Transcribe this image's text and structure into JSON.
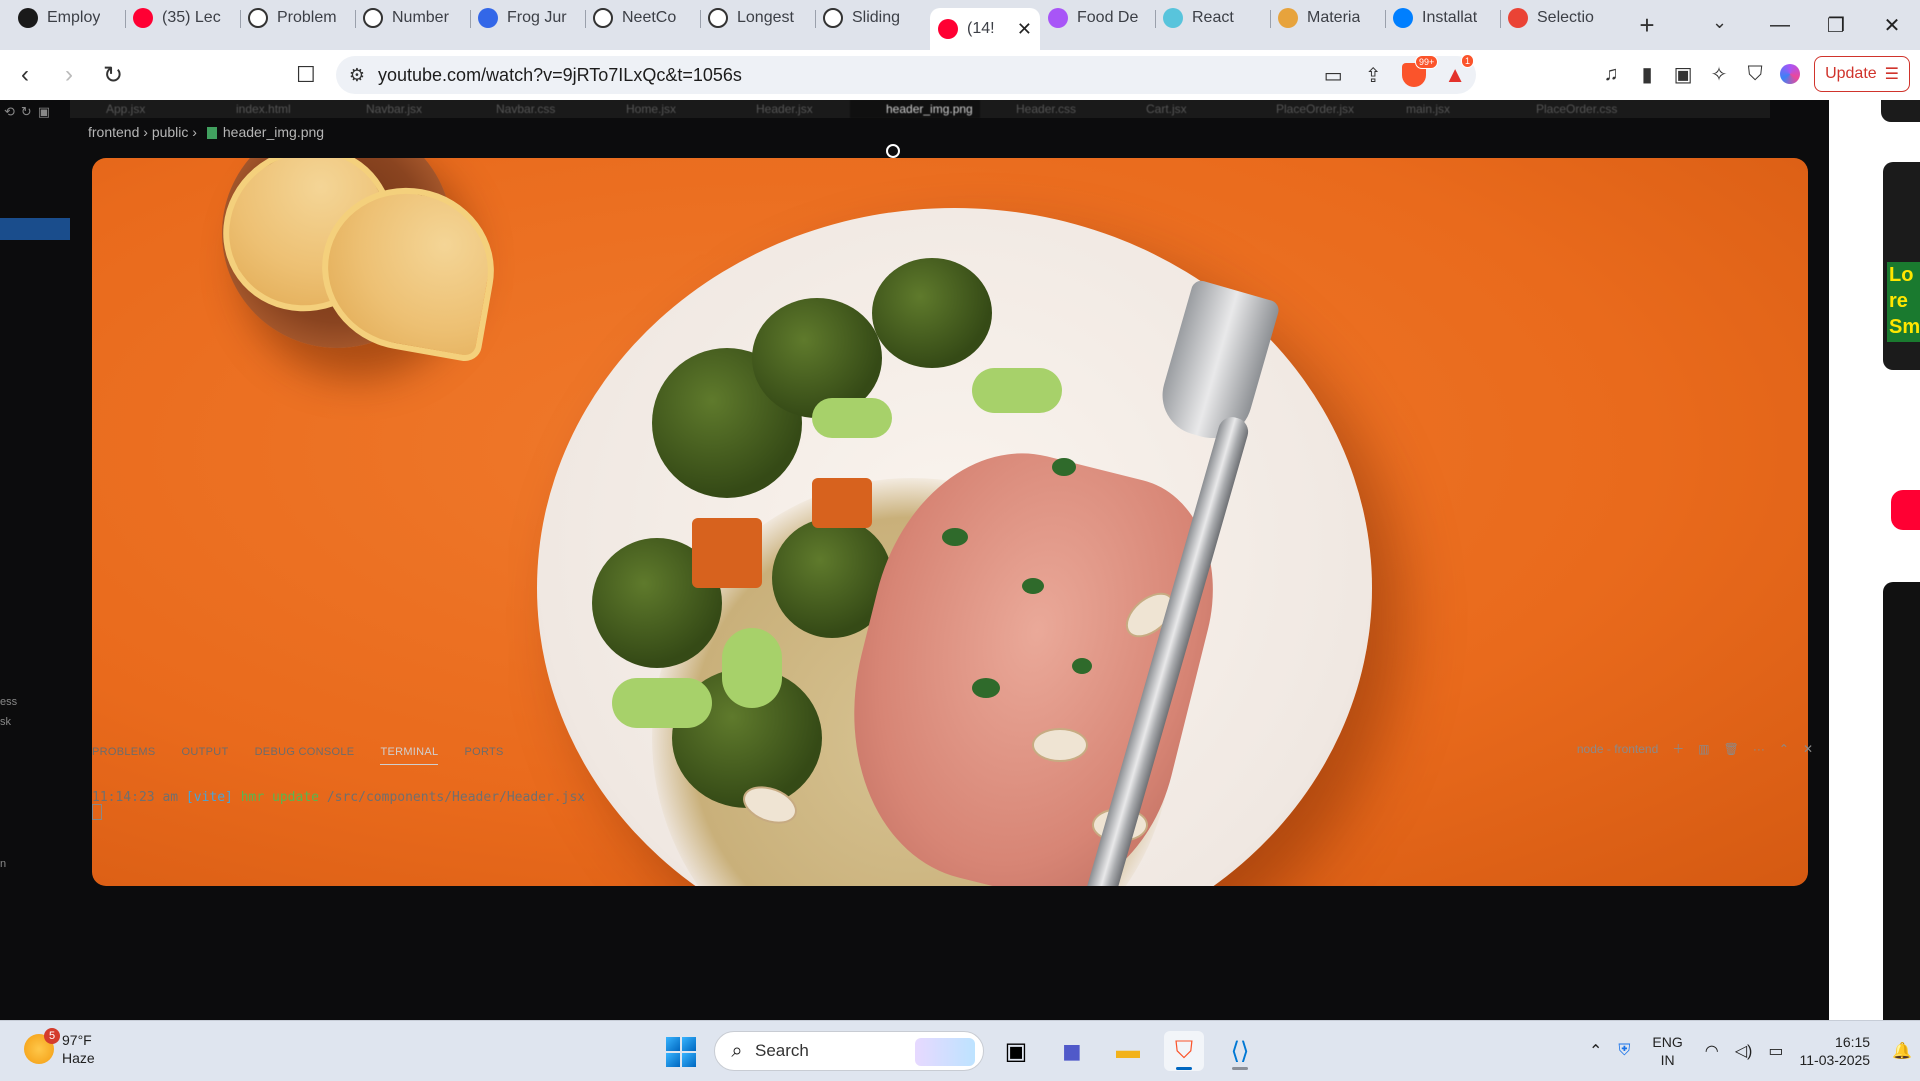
{
  "browser": {
    "tabs": [
      {
        "label": "Employ",
        "icon": "openai-icon",
        "color": "#1a1a1a"
      },
      {
        "label": "(35) Lec",
        "icon": "youtube-icon",
        "color": "#ff0033"
      },
      {
        "label": "Problem",
        "icon": "leetcode-icon",
        "color": "#ffffff"
      },
      {
        "label": "Number",
        "icon": "leetcode-icon",
        "color": "#ffffff"
      },
      {
        "label": "Frog Jur",
        "icon": "codolio-icon",
        "color": "#3367e8"
      },
      {
        "label": "NeetCo",
        "icon": "rocket-icon",
        "color": "#ffffff"
      },
      {
        "label": "Longest",
        "icon": "leetcode-icon",
        "color": "#ffffff"
      },
      {
        "label": "Sliding",
        "icon": "leetcode-icon",
        "color": "#ffffff"
      },
      {
        "label": "(14!",
        "icon": "youtube-icon",
        "color": "#ff0033",
        "active": true
      },
      {
        "label": "Food De",
        "icon": "vite-icon",
        "color": "#a855f7"
      },
      {
        "label": "React",
        "icon": "react-icon",
        "color": "#58c4dc"
      },
      {
        "label": "Materia",
        "icon": "material-icon",
        "color": "#e7a33c"
      },
      {
        "label": "Installat",
        "icon": "mui-icon",
        "color": "#007fff"
      },
      {
        "label": "Selectio",
        "icon": "google-icon",
        "color": "#ea4335"
      }
    ],
    "new_tab": "+",
    "url": "youtube.com/watch?v=9jRTo7ILxQc&t=1056s",
    "shields_badge": "99+",
    "rewards_badge": "1",
    "update_label": "Update"
  },
  "video": {
    "editor_tabs": [
      "App.jsx",
      "index.html",
      "Navbar.jsx",
      "Navbar.css",
      "Home.jsx",
      "Header.jsx",
      "header_img.png",
      "Header.css",
      "Cart.jsx",
      "PlaceOrder.jsx",
      "main.jsx",
      "PlaceOrder.css"
    ],
    "active_editor_tab": "header_img.png",
    "breadcrumb": [
      "frontend",
      "public",
      "header_img.png"
    ],
    "side_labels": [
      "ess",
      "sk",
      "n"
    ],
    "panel_tabs": [
      "PROBLEMS",
      "OUTPUT",
      "DEBUG CONSOLE",
      "TERMINAL",
      "PORTS"
    ],
    "active_panel_tab": "TERMINAL",
    "terminal_session": "node - frontend",
    "terminal": {
      "time": "11:14:23 am",
      "tag": "[vite]",
      "event": "hmr update",
      "path": "/src/components/Header/Header.jsx"
    }
  },
  "right_strip": {
    "thumb_text": "Lo re Sm"
  },
  "taskbar": {
    "weather_temp": "97°F",
    "weather_cond": "Haze",
    "weather_badge": "5",
    "search_label": "Search",
    "lang_1": "ENG",
    "lang_2": "IN",
    "time": "16:15",
    "date": "11-03-2025"
  }
}
